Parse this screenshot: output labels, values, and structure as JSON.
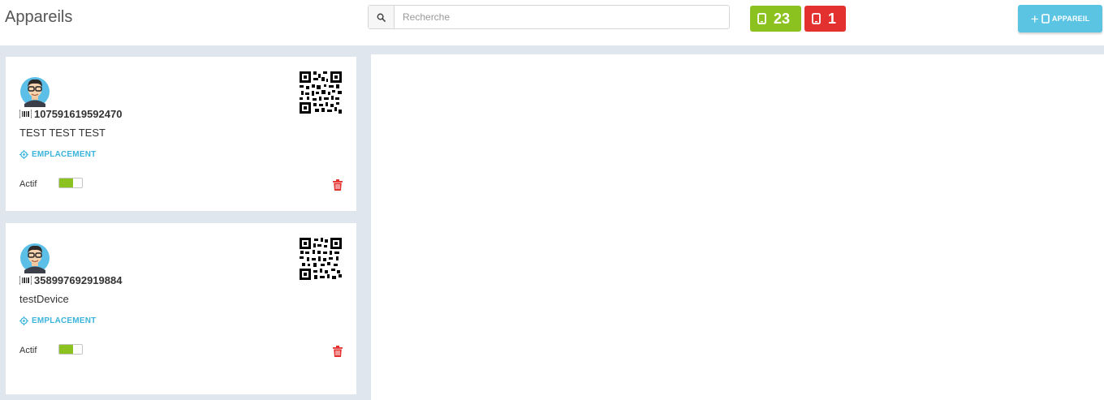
{
  "header": {
    "title": "Appareils",
    "search": {
      "placeholder": "Recherche",
      "value": "",
      "icon": "search-icon"
    },
    "badges": [
      {
        "name": "online-devices",
        "count": "23",
        "color": "#8cc21f",
        "icon": "tablet-icon"
      },
      {
        "name": "offline-devices",
        "count": "1",
        "color": "#e3312f",
        "icon": "tablet-icon"
      }
    ],
    "add_button": {
      "label": "APPAREIL",
      "icon": "plus-tablet-icon",
      "color": "#5bc4e3"
    }
  },
  "devices": [
    {
      "imei": "107591619592470",
      "name": "TEST TEST TEST",
      "location_label": "EMPLACEMENT",
      "status_label": "Actif",
      "active": true,
      "toggle_fill": 0.6
    },
    {
      "imei": "358997692919884",
      "name": "testDevice",
      "location_label": "EMPLACEMENT",
      "status_label": "Actif",
      "active": true,
      "toggle_fill": 0.6
    }
  ],
  "colors": {
    "accent": "#3bb4dc",
    "active": "#8cc21f",
    "danger": "#e3312f"
  }
}
